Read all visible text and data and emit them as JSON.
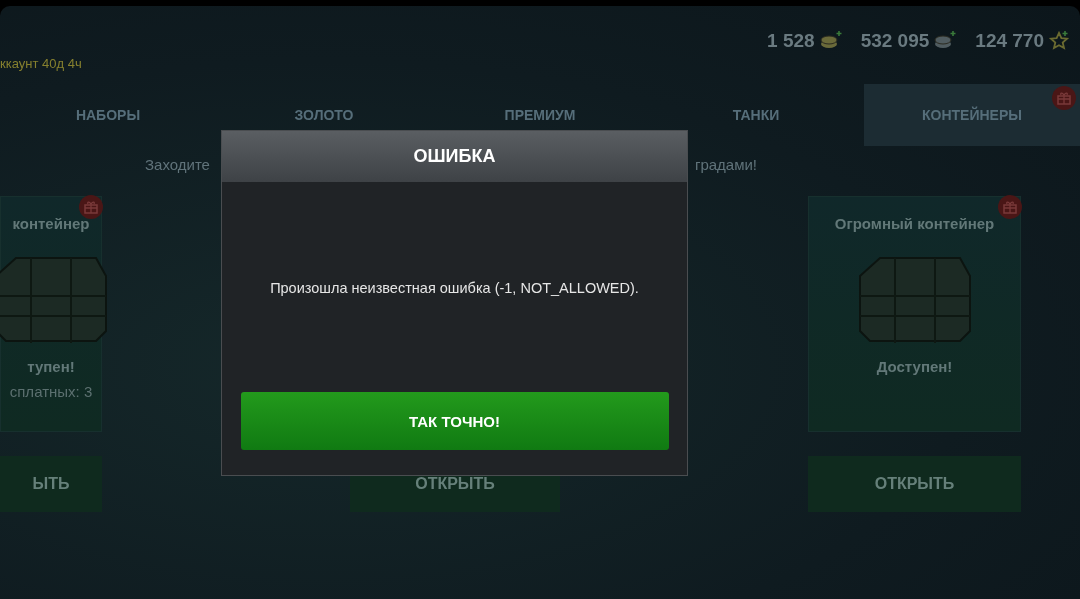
{
  "header": {
    "account": "ккаунт 40д 4ч",
    "currencies": [
      {
        "kind": "gold",
        "amount": "1 528"
      },
      {
        "kind": "silver",
        "amount": "532 095"
      },
      {
        "kind": "xp",
        "amount": "124 770"
      }
    ]
  },
  "tabs": [
    {
      "label": "НАБОРЫ",
      "selected": false,
      "badge": false
    },
    {
      "label": "ЗОЛОТО",
      "selected": false,
      "badge": false
    },
    {
      "label": "ПРЕМИУМ",
      "selected": false,
      "badge": false
    },
    {
      "label": "ТАНКИ",
      "selected": false,
      "badge": false
    },
    {
      "label": "КОНТЕЙНЕРЫ",
      "selected": true,
      "badge": true
    }
  ],
  "banner": [
    "Заходите",
    "градами!"
  ],
  "cards": [
    {
      "title": "контейнер",
      "status": "тупен!",
      "note": "сплатных: 3",
      "button": "ЫТЬ",
      "badge": true,
      "picture": true
    },
    {
      "button": "ОТКРЫТЬ"
    },
    {
      "title": "Огромный контейнер",
      "status": "Доступен!",
      "button": "ОТКРЫТЬ",
      "badge": true,
      "picture": true
    }
  ],
  "dialog": {
    "title": "ОШИБКА",
    "message": "Произошла неизвестная ошибка (-1, NOT_ALLOWED).",
    "button": "ТАК ТОЧНО!"
  }
}
